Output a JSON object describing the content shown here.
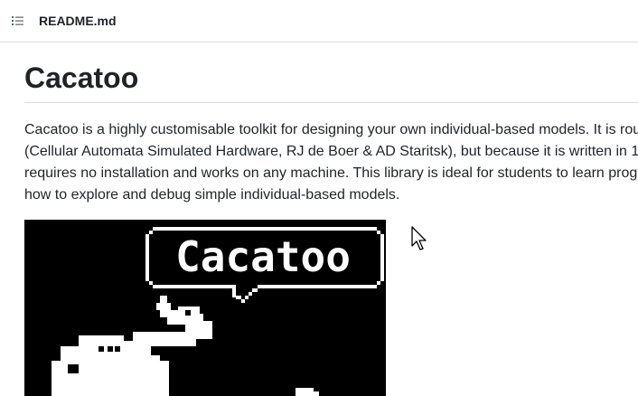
{
  "header": {
    "file_name": "README.md",
    "toc_icon": "list-unordered-icon"
  },
  "readme": {
    "title": "Cacatoo",
    "paragraph_lines": [
      "Cacatoo is a highly customisable toolkit for designing your own individual-based models. It is rou",
      "(Cellular Automata Simulated Hardware, RJ de Boer & AD Staritsk), but because it is written in 10",
      "requires no installation and works on any machine. This library is ideal for students to learn progr",
      "how to explore and debug simple individual-based models."
    ],
    "logo": {
      "speech_bubble_text": "Cacatoo",
      "background": "#000000",
      "foreground": "#ffffff"
    }
  },
  "colors": {
    "text": "#1f2328",
    "border": "#d8dee4"
  }
}
